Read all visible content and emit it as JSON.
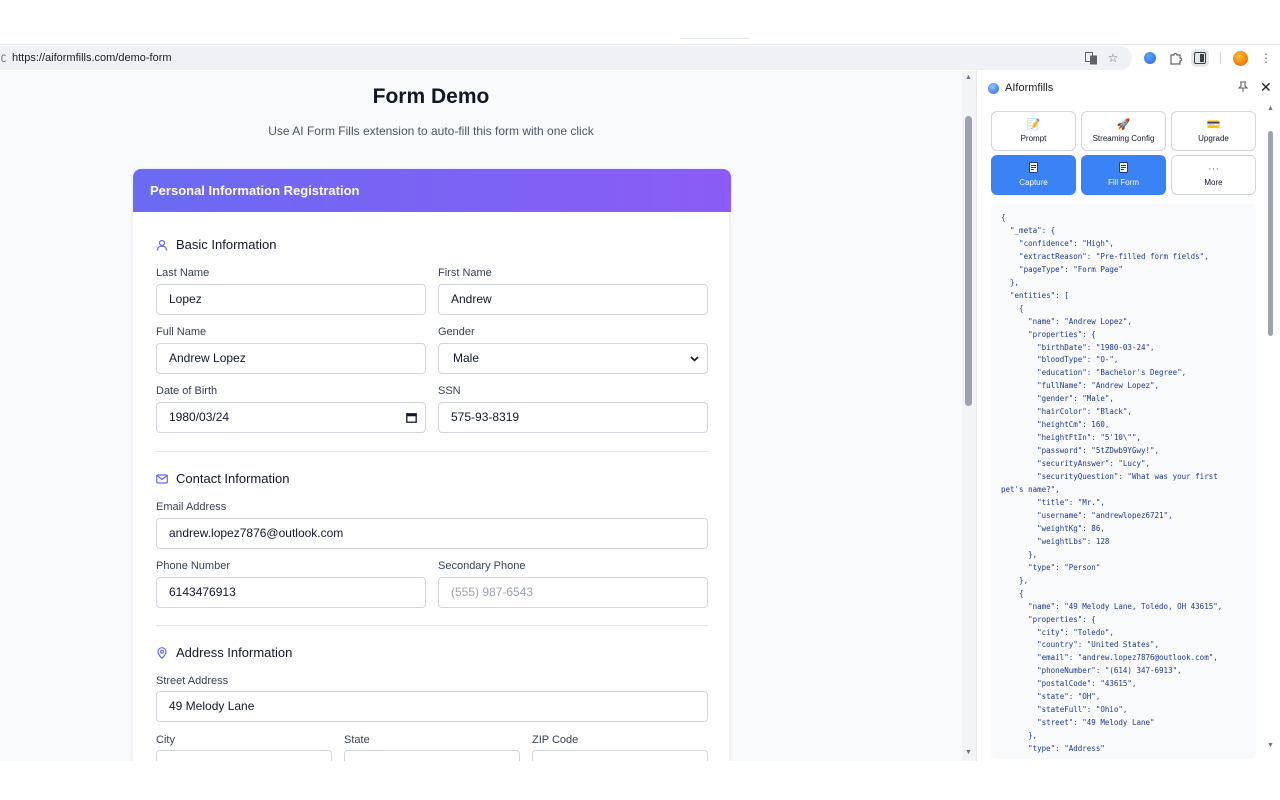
{
  "browser": {
    "url_glyph": "ʗ",
    "url": "https://aiformfills.com/demo-form"
  },
  "page": {
    "title": "Form Demo",
    "subtitle": "Use AI Form Fills extension to auto-fill this form with one click",
    "card_title": "Personal Information Registration",
    "sections": {
      "basic": "Basic Information",
      "contact": "Contact Information",
      "address": "Address Information"
    },
    "fields": {
      "last_name": {
        "label": "Last Name",
        "value": "Lopez"
      },
      "first_name": {
        "label": "First Name",
        "value": "Andrew"
      },
      "full_name": {
        "label": "Full Name",
        "value": "Andrew Lopez"
      },
      "gender": {
        "label": "Gender",
        "value": "Male"
      },
      "dob": {
        "label": "Date of Birth",
        "value": "1980/03/24"
      },
      "ssn": {
        "label": "SSN",
        "value": "575-93-8319"
      },
      "email": {
        "label": "Email Address",
        "value": "andrew.lopez7876@outlook.com"
      },
      "phone": {
        "label": "Phone Number",
        "value": "6143476913"
      },
      "secondary_phone": {
        "label": "Secondary Phone",
        "placeholder": "(555) 987-6543"
      },
      "street": {
        "label": "Street Address",
        "value": "49 Melody Lane"
      },
      "city": {
        "label": "City"
      },
      "state": {
        "label": "State"
      },
      "zip": {
        "label": "ZIP Code"
      }
    }
  },
  "panel": {
    "title": "AIformfills",
    "buttons": {
      "prompt": "Prompt",
      "streaming": "Streaming Config",
      "upgrade": "Upgrade",
      "capture": "Capture",
      "fill": "Fill Form",
      "more": "More"
    },
    "json_lines": [
      "{",
      "  \"_meta\": {",
      "    \"confidence\": \"High\",",
      "    \"extractReason\": \"Pre-filled form fields\",",
      "    \"pageType\": \"Form Page\"",
      "  },",
      "  \"entities\": [",
      "    {",
      "      \"name\": \"Andrew Lopez\",",
      "      \"properties\": {",
      "        \"birthDate\": \"1980-03-24\",",
      "        \"bloodType\": \"O-\",",
      "        \"education\": \"Bachelor's Degree\",",
      "        \"fullName\": \"Andrew Lopez\",",
      "        \"gender\": \"Male\",",
      "        \"hairColor\": \"Black\",",
      "        \"heightCm\": 160,",
      "        \"heightFtIn\": \"5'10\\\"\",",
      "        \"password\": \"5tZDwb9YGwy!\",",
      "        \"securityAnswer\": \"Lucy\",",
      "        \"securityQuestion\": \"What was your first",
      "pet's name?\",",
      "        \"title\": \"Mr.\",",
      "        \"username\": \"andrewlopez6721\",",
      "        \"weightKg\": 86,",
      "        \"weightLbs\": 128",
      "      },",
      "      \"type\": \"Person\"",
      "    },",
      "    {",
      "      \"name\": \"49 Melody Lane, Toledo, OH 43615\",",
      "      \"properties\": {",
      "        \"city\": \"Toledo\",",
      "        \"country\": \"United States\",",
      "        \"email\": \"andrew.lopez7876@outlook.com\",",
      "        \"phoneNumber\": \"(614) 347-6913\",",
      "        \"postalCode\": \"43615\",",
      "        \"state\": \"OH\",",
      "        \"stateFull\": \"Ohio\",",
      "        \"street\": \"49 Melody Lane\"",
      "      },",
      "      \"type\": \"Address\""
    ]
  },
  "colors": {
    "header_gradient_start": "#6a6af3",
    "header_gradient_end": "#8b5cf6",
    "primary_button": "#3b82f6",
    "json_text": "#1e3a8a"
  }
}
